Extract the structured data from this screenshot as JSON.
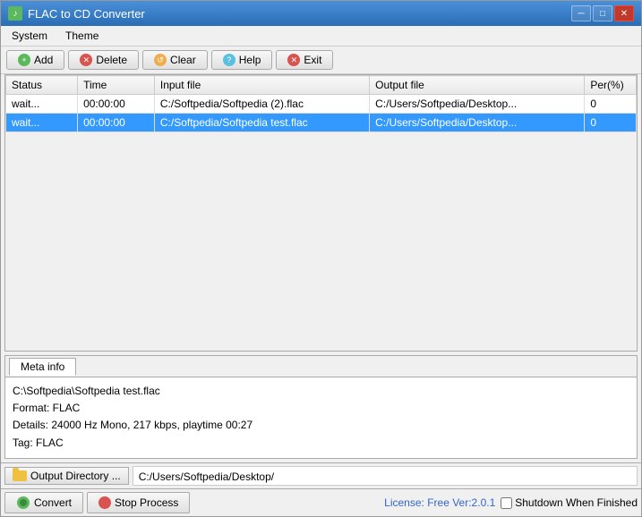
{
  "window": {
    "title": "FLAC to CD Converter",
    "icon": "♪"
  },
  "titlebar": {
    "minimize": "─",
    "maximize": "□",
    "close": "✕"
  },
  "menu": {
    "items": [
      "System",
      "Theme"
    ]
  },
  "toolbar": {
    "buttons": [
      {
        "label": "Add",
        "icon": "green",
        "symbol": "+"
      },
      {
        "label": "Delete",
        "icon": "red",
        "symbol": "✕"
      },
      {
        "label": "Clear",
        "icon": "orange",
        "symbol": "↺"
      },
      {
        "label": "Help",
        "icon": "blue",
        "symbol": "?"
      },
      {
        "label": "Exit",
        "icon": "red",
        "symbol": "✕"
      }
    ]
  },
  "table": {
    "columns": [
      "Status",
      "Time",
      "Input file",
      "Output file",
      "Per(%)"
    ],
    "rows": [
      {
        "status": "wait...",
        "time": "00:00:00",
        "input": "C:/Softpedia/Softpedia (2).flac",
        "output": "C:/Users/Softpedia/Desktop...",
        "percent": "0",
        "selected": false
      },
      {
        "status": "wait...",
        "time": "00:00:00",
        "input": "C:/Softpedia/Softpedia test.flac",
        "output": "C:/Users/Softpedia/Desktop...",
        "percent": "0",
        "selected": true
      }
    ]
  },
  "meta": {
    "tab_label": "Meta info",
    "content_lines": [
      "C:\\Softpedia\\Softpedia test.flac",
      "Format:  FLAC",
      "Details: 24000 Hz Mono, 217 kbps, playtime 00:27",
      "Tag:     FLAC"
    ]
  },
  "output_dir": {
    "button_label": "Output Directory ...",
    "path": "C:/Users/Softpedia/Desktop/"
  },
  "bottom": {
    "convert_label": "Convert",
    "stop_label": "Stop Process",
    "license_text": "License: Free Ver:2.0.1",
    "shutdown_label": "Shutdown When Finished"
  }
}
